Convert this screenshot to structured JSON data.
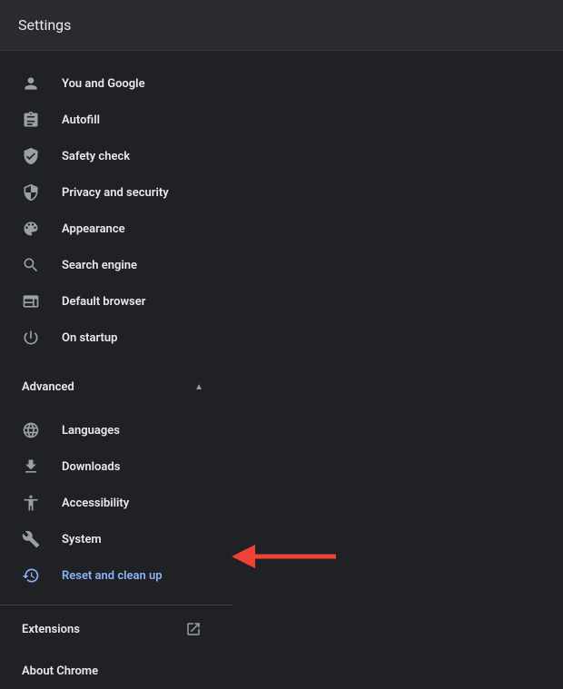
{
  "header": {
    "title": "Settings"
  },
  "sidebar": {
    "items": [
      {
        "label": "You and Google"
      },
      {
        "label": "Autofill"
      },
      {
        "label": "Safety check"
      },
      {
        "label": "Privacy and security"
      },
      {
        "label": "Appearance"
      },
      {
        "label": "Search engine"
      },
      {
        "label": "Default browser"
      },
      {
        "label": "On startup"
      }
    ],
    "advanced": {
      "label": "Advanced",
      "items": [
        {
          "label": "Languages"
        },
        {
          "label": "Downloads"
        },
        {
          "label": "Accessibility"
        },
        {
          "label": "System"
        },
        {
          "label": "Reset and clean up"
        }
      ]
    },
    "footer": [
      {
        "label": "Extensions"
      },
      {
        "label": "About Chrome"
      }
    ]
  }
}
